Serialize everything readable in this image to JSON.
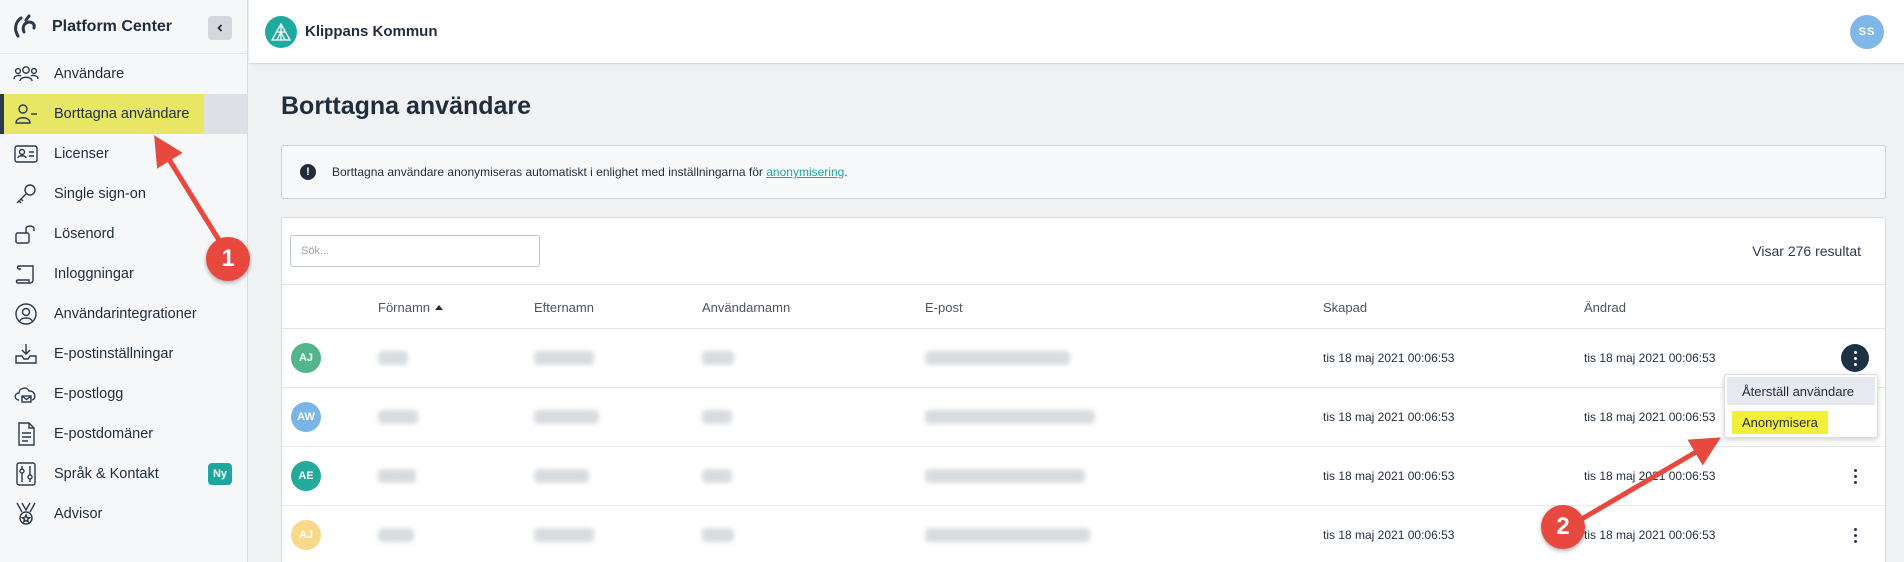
{
  "sidebar": {
    "brand": "Platform Center",
    "items": [
      {
        "label": "Användare",
        "icon": "users-icon"
      },
      {
        "label": "Borttagna användare",
        "icon": "user-minus-icon",
        "active": true
      },
      {
        "label": "Licenser",
        "icon": "id-card-icon"
      },
      {
        "label": "Single sign-on",
        "icon": "key-icon"
      },
      {
        "label": "Lösenord",
        "icon": "lock-open-icon"
      },
      {
        "label": "Inloggningar",
        "icon": "scroll-icon"
      },
      {
        "label": "Användarintegrationer",
        "icon": "user-circle-icon"
      },
      {
        "label": "E-postinställningar",
        "icon": "inbox-download-icon"
      },
      {
        "label": "E-postlogg",
        "icon": "cloud-mail-icon"
      },
      {
        "label": "E-postdomäner",
        "icon": "document-icon"
      },
      {
        "label": "Språk & Kontakt",
        "icon": "sliders-icon",
        "badge": "Ny"
      },
      {
        "label": "Advisor",
        "icon": "medal-icon"
      }
    ]
  },
  "topbar": {
    "org_name": "Klippans Kommun",
    "user_initials": "SS"
  },
  "main": {
    "title": "Borttagna användare",
    "info_text": "Borttagna användare anonymiseras automatiskt i enlighet med inställningarna för ",
    "info_link": "anonymisering",
    "info_suffix": ".",
    "search_placeholder": "Sök...",
    "result_count": "Visar 276 resultat"
  },
  "table": {
    "columns": [
      "Förnamn",
      "Efternamn",
      "Användarnamn",
      "E-post",
      "Skapad",
      "Ändrad"
    ],
    "rows": [
      {
        "initials": "AJ",
        "color": "#52b58c",
        "created": "tis 18 maj 2021 00:06:53",
        "modified": "tis 18 maj 2021 00:06:53"
      },
      {
        "initials": "AW",
        "color": "#79b6e6",
        "created": "tis 18 maj 2021 00:06:53",
        "modified": "tis 18 maj 2021 00:06:53"
      },
      {
        "initials": "AE",
        "color": "#24a99d",
        "created": "tis 18 maj 2021 00:06:53",
        "modified": "tis 18 maj 2021 00:06:53"
      },
      {
        "initials": "AJ",
        "color": "#f8d98a",
        "created": "tis 18 maj 2021 00:06:53",
        "modified": "tis 18 maj 2021 00:06:53"
      }
    ]
  },
  "row_menu": {
    "restore": "Återställ användare",
    "anonymize": "Anonymisera"
  },
  "annotations": {
    "step1": "1",
    "step2": "2"
  }
}
